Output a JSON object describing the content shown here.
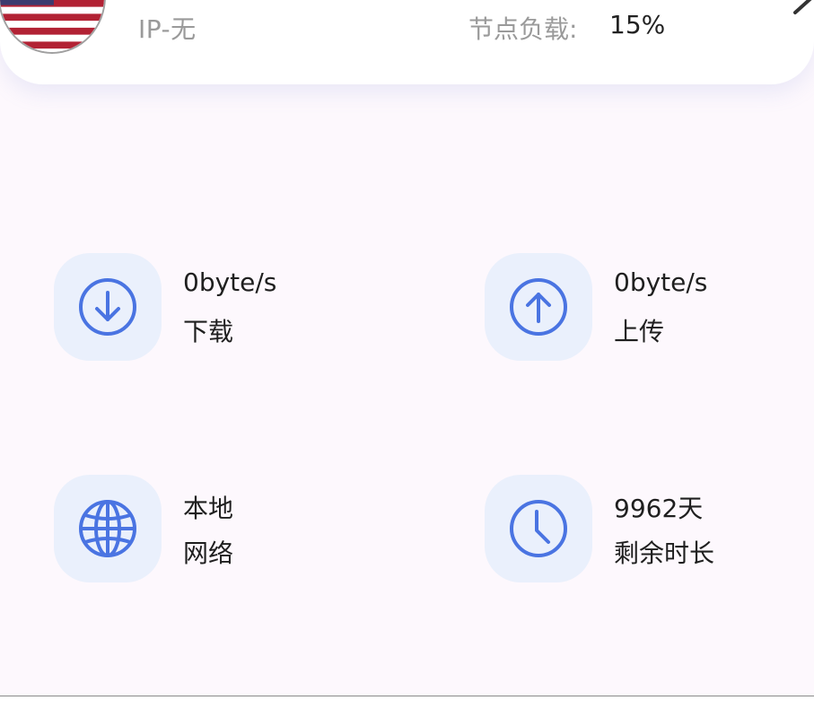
{
  "server_card": {
    "ip_text": "IP-无",
    "load_label": "节点负载:",
    "load_value": "15%",
    "flag_icon": "us-flag-icon",
    "edit_icon": "pencil-icon"
  },
  "stats": [
    {
      "icon": "download-arrow-icon",
      "value": "0byte/s",
      "label": "下载"
    },
    {
      "icon": "upload-arrow-icon",
      "value": "0byte/s",
      "label": "上传"
    },
    {
      "icon": "globe-icon",
      "value": "本地",
      "label": "网络"
    },
    {
      "icon": "clock-icon",
      "value": "9962天",
      "label": "剩余时长"
    }
  ],
  "colors": {
    "accent": "#4a74e2",
    "icon_bg": "#eaf0fc",
    "page_bg": "#fdf8fd",
    "text_primary": "#1f1f1f",
    "text_muted": "#9a9a9a"
  }
}
